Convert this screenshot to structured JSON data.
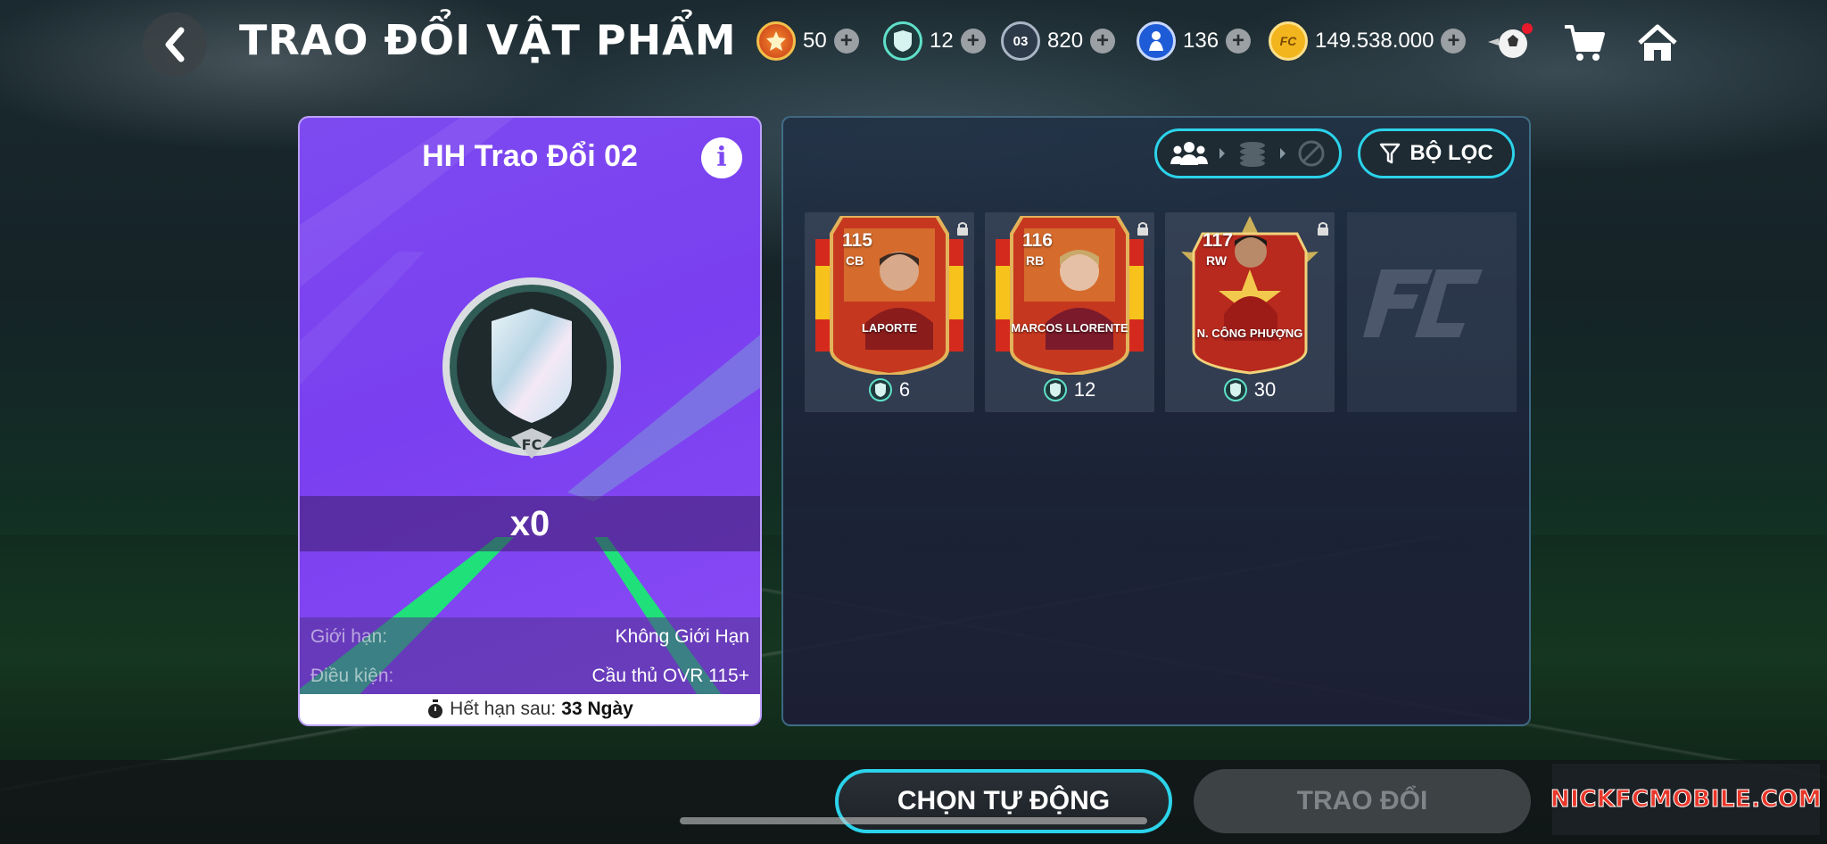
{
  "header": {
    "title": "TRAO ĐỔI VẬT PHẨM",
    "currencies": [
      {
        "icon": "red-token-icon",
        "value": "50"
      },
      {
        "icon": "silver-shield-icon",
        "value": "12"
      },
      {
        "icon": "card-03-icon",
        "badge": "03",
        "value": "820"
      },
      {
        "icon": "player-token-icon",
        "value": "136"
      },
      {
        "icon": "fc-coin-icon",
        "value": "149.538.000"
      }
    ]
  },
  "exchange_card": {
    "title": "HH Trao Đổi 02",
    "quantity": "x0",
    "limit_label": "Giới hạn:",
    "limit_value": "Không Giới Hạn",
    "condition_label": "Điều kiện:",
    "condition_value": "Cầu thủ OVR 115+",
    "expire_label": "Hết hạn sau:",
    "expire_value": "33 Ngày"
  },
  "filter": {
    "label": "BỘ LỌC"
  },
  "players": [
    {
      "ovr": "115",
      "pos": "CB",
      "name": "LAPORTE",
      "cost": "6",
      "card_style": "spain-gold"
    },
    {
      "ovr": "116",
      "pos": "RB",
      "name": "MARCOS LLORENTE",
      "cost": "12",
      "card_style": "spain-gold"
    },
    {
      "ovr": "117",
      "pos": "RW",
      "name": "N. CÔNG PHƯỢNG",
      "cost": "30",
      "card_style": "vietnam-star"
    }
  ],
  "buttons": {
    "auto_select": "CHỌN TỰ ĐỘNG",
    "trade": "TRAO ĐỔI"
  },
  "watermark": "NICKFCMOBILE.COM",
  "colors": {
    "accent_cyan": "#2bd3ea",
    "card_purple": "#7d4af0",
    "coin_gold": "#f2b51e"
  }
}
